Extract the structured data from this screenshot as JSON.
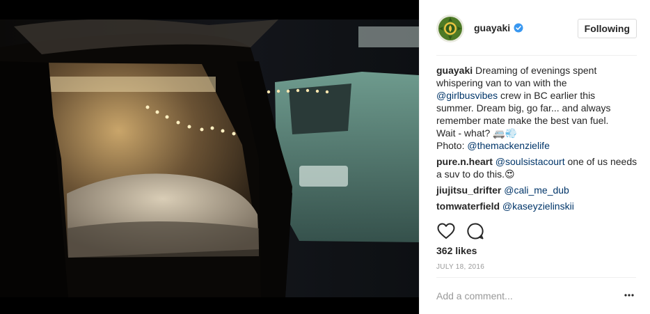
{
  "post": {
    "account": {
      "username": "guayaki",
      "verified": true,
      "follow_label": "Following"
    },
    "caption": {
      "author": "guayaki",
      "text_1": "Dreaming of evenings spent",
      "text_2": "whispering van to van with the",
      "mention_1": "@girlbusvibes",
      "text_3": " crew in BC earlier this",
      "text_4": "summer. Dream big, go far... and always",
      "text_5": "remember mate make the best van fuel.",
      "text_6": "Wait - what? 🚐💨",
      "text_7": "Photo: ",
      "mention_2": "@themackenzielife"
    },
    "comments": [
      {
        "author": "pure.n.heart",
        "mention": "@soulsistacourt",
        "text": " one of us needs a suv to do this.😍"
      },
      {
        "author": "jiujitsu_drifter",
        "mention": "@cali_me_dub",
        "text": ""
      },
      {
        "author": "tomwaterfield",
        "mention": "@kaseyzielinskii",
        "text": ""
      }
    ],
    "likes": "362 likes",
    "date": "JULY 18, 2016",
    "comment_placeholder": "Add a comment...",
    "icons": [
      "heart-icon",
      "comment-icon",
      "verified-icon",
      "more-options-icon"
    ],
    "colors": {
      "mention": "#003569",
      "verified": "#3897f0",
      "muted": "#999999"
    }
  }
}
